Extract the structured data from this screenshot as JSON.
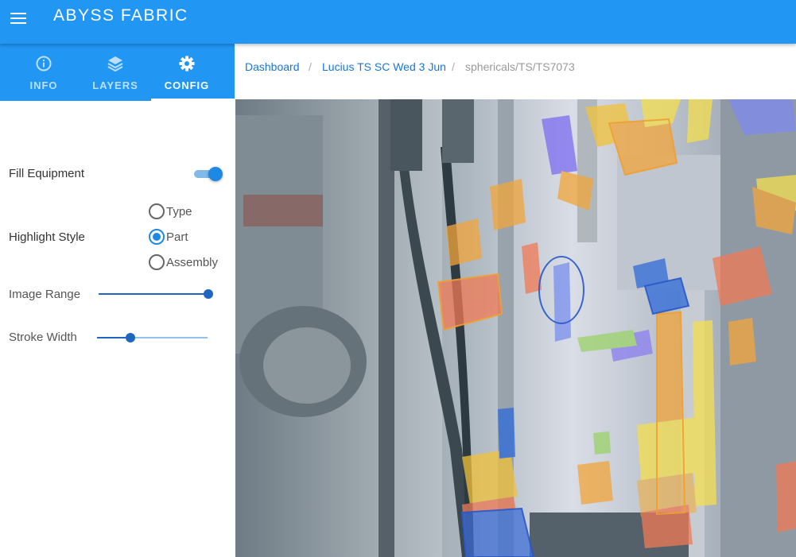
{
  "app": {
    "brand": "ABYSS FABRIC"
  },
  "tabs": [
    {
      "label": "INFO",
      "icon": "info-icon"
    },
    {
      "label": "LAYERS",
      "icon": "layers-icon"
    },
    {
      "label": "CONFIG",
      "icon": "gear-icon",
      "active": true
    }
  ],
  "config": {
    "fill_equipment": {
      "label": "Fill Equipment",
      "on": true
    },
    "highlight_style": {
      "label": "Highlight Style",
      "options": [
        "Type",
        "Part",
        "Assembly"
      ],
      "selected": "Part"
    },
    "image_range": {
      "label": "Image Range",
      "value": 1.0
    },
    "stroke_width": {
      "label": "Stroke Width",
      "value": 0.3
    }
  },
  "breadcrumb": [
    "Dashboard",
    "Lucius TS SC Wed 3 Jun",
    "sphericals/TS/TS7073"
  ],
  "colors": {
    "primary": "#2196f3",
    "accent": "#1e88e5",
    "link": "#1976d2"
  }
}
